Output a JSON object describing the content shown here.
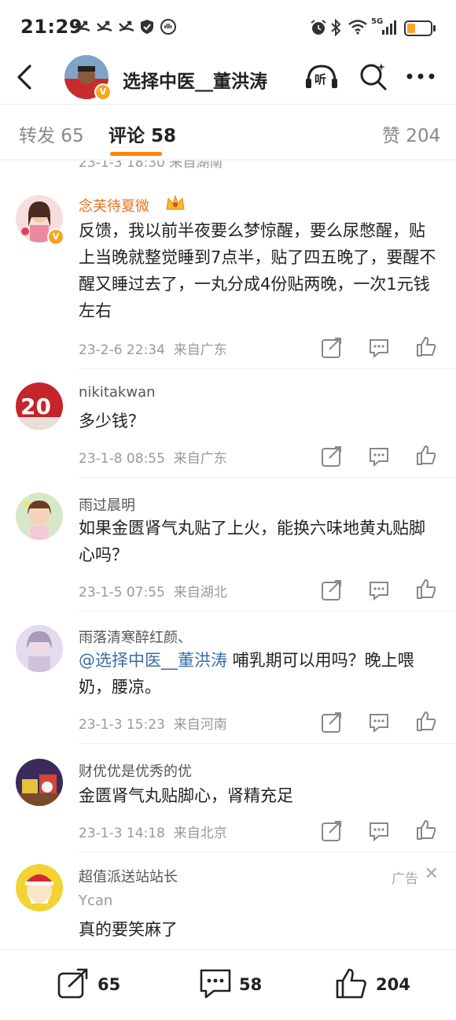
{
  "status": {
    "time": "21:29",
    "signal_label": "5G"
  },
  "header": {
    "title": "选择中医__董洪涛",
    "listen_label": "听"
  },
  "tabs": [
    {
      "label": "转发 65"
    },
    {
      "label": "评论 58"
    },
    {
      "label": "赞 204"
    }
  ],
  "previous": {
    "meta": "23-1-3 18:30 来自湖南"
  },
  "comments": [
    {
      "user": "念芙待夏微",
      "text": "反馈，我以前半夜要么梦惊醒，要么尿憋醒，贴上当晚就整觉睡到7点半，贴了四五晚了，要醒不醒又睡过去了，一丸分成4份贴两晚，一次1元钱左右",
      "date": "23-2-6 22:34",
      "source": "来自广东"
    },
    {
      "user": "nikitakwan",
      "text": "多少钱？",
      "date": "23-1-8 08:55",
      "source": "来自广东"
    },
    {
      "user": "雨过晨明",
      "text": "如果金匮肾气丸贴了上火，能换六味地黄丸贴脚心吗？",
      "date": "23-1-5 07:55",
      "source": "来自湖北"
    },
    {
      "user": "雨落清寒醉红颜、",
      "mention": "@选择中医__董洪涛",
      "text": " 哺乳期可以用吗？晚上喂奶，腰凉。",
      "date": "23-1-3 15:23",
      "source": "来自河南"
    },
    {
      "user": "财优优是优秀的优",
      "text": "金匮肾气丸贴脚心，肾精充足",
      "date": "23-1-3 14:18",
      "source": "来自北京"
    }
  ],
  "ad": {
    "user": "超值派送站站长",
    "sub": "Ycan",
    "text": "真的要笑麻了",
    "tag": "广告"
  },
  "bottom": {
    "repost_count": "65",
    "comment_count": "58",
    "like_count": "204"
  },
  "colors": {
    "accent": "#ff8200",
    "mention": "#3a6ea5",
    "vip_name": "#e6731e"
  }
}
